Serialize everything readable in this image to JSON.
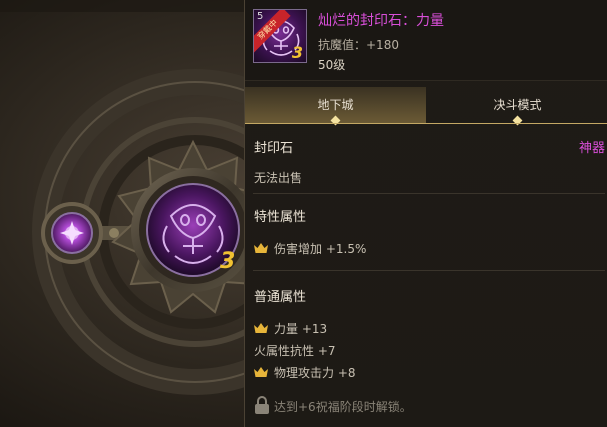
{
  "item": {
    "icon_name": "seal-stone-icon",
    "icon_level": "5",
    "icon_ribbon": "穿戴中",
    "icon_tier": "3",
    "name": "灿烂的封印石：力量",
    "resist_stat": "抗魔值：+180",
    "level": "50级",
    "name_color": "#d94fd9"
  },
  "tabs": [
    {
      "label": "地下城",
      "active": true
    },
    {
      "label": "决斗模式",
      "active": false
    }
  ],
  "body": {
    "type_label": "封印石",
    "rarity": "神器",
    "trade": "无法出售",
    "special_title": "特性属性",
    "special_attrs": [
      "伤害增加 +1.5%"
    ],
    "normal_title": "普通属性",
    "normal_attrs": [
      {
        "text": "力量 +13",
        "icon": "crown-icon"
      },
      {
        "text": "火属性抗性 +7",
        "icon": ""
      },
      {
        "text": "物理攻击力 +8",
        "icon": "crown-icon"
      }
    ],
    "unlock_hint": "达到+6祝福阶段时解锁。"
  },
  "scene": {
    "center_tier": "3",
    "center_icon": "seal-emblem-icon",
    "left_icon": "purple-star-gem-icon"
  }
}
